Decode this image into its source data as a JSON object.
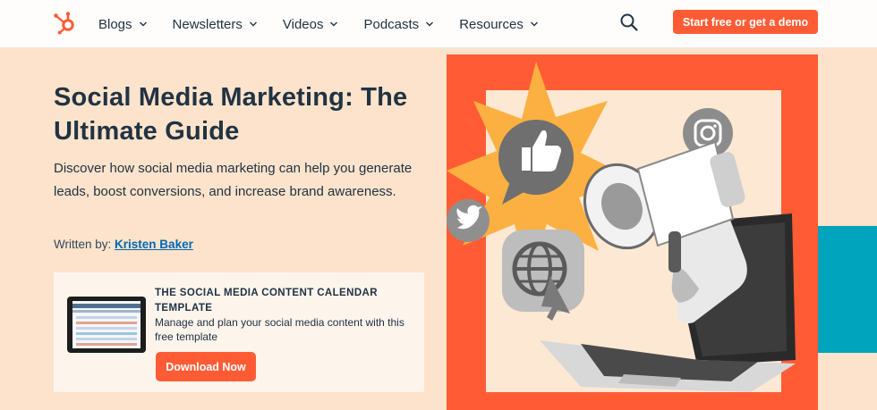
{
  "nav": {
    "items": [
      {
        "label": "Blogs"
      },
      {
        "label": "Newsletters"
      },
      {
        "label": "Videos"
      },
      {
        "label": "Podcasts"
      },
      {
        "label": "Resources"
      }
    ],
    "cta_label": "Start free or get a demo",
    "brand_color": "#ff5c35"
  },
  "hero": {
    "title": "Social Media Marketing: The Ultimate Guide",
    "description": "Discover how social media marketing can help you generate leads, boost conversions, and increase brand awareness.",
    "byline_prefix": "Written by:",
    "author": "Kristen Baker"
  },
  "offer": {
    "title": "THE SOCIAL MEDIA CONTENT CALENDAR TEMPLATE",
    "description": "Manage and plan your social media content with this free template",
    "button_label": "Download Now"
  },
  "icons": {
    "logo": "hubspot-sprocket-icon",
    "search": "search-icon",
    "chevron": "chevron-down-icon"
  },
  "colors": {
    "background": "#fde3cb",
    "accent": "#ff5c35",
    "link": "#0068b3",
    "text": "#213343",
    "teal": "#00a4bd"
  }
}
